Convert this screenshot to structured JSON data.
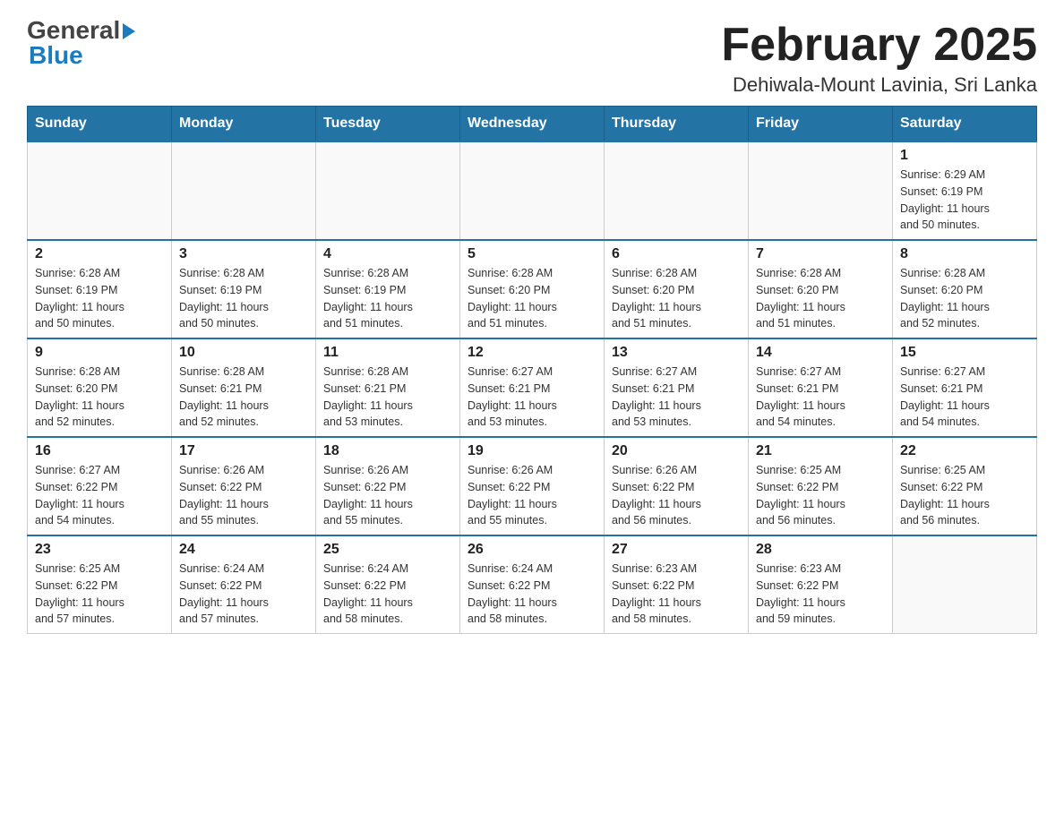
{
  "header": {
    "logo": {
      "line1": "General",
      "line2": "Blue"
    },
    "title": "February 2025",
    "subtitle": "Dehiwala-Mount Lavinia, Sri Lanka"
  },
  "days_of_week": [
    "Sunday",
    "Monday",
    "Tuesday",
    "Wednesday",
    "Thursday",
    "Friday",
    "Saturday"
  ],
  "weeks": [
    [
      {
        "day": "",
        "info": ""
      },
      {
        "day": "",
        "info": ""
      },
      {
        "day": "",
        "info": ""
      },
      {
        "day": "",
        "info": ""
      },
      {
        "day": "",
        "info": ""
      },
      {
        "day": "",
        "info": ""
      },
      {
        "day": "1",
        "info": "Sunrise: 6:29 AM\nSunset: 6:19 PM\nDaylight: 11 hours\nand 50 minutes."
      }
    ],
    [
      {
        "day": "2",
        "info": "Sunrise: 6:28 AM\nSunset: 6:19 PM\nDaylight: 11 hours\nand 50 minutes."
      },
      {
        "day": "3",
        "info": "Sunrise: 6:28 AM\nSunset: 6:19 PM\nDaylight: 11 hours\nand 50 minutes."
      },
      {
        "day": "4",
        "info": "Sunrise: 6:28 AM\nSunset: 6:19 PM\nDaylight: 11 hours\nand 51 minutes."
      },
      {
        "day": "5",
        "info": "Sunrise: 6:28 AM\nSunset: 6:20 PM\nDaylight: 11 hours\nand 51 minutes."
      },
      {
        "day": "6",
        "info": "Sunrise: 6:28 AM\nSunset: 6:20 PM\nDaylight: 11 hours\nand 51 minutes."
      },
      {
        "day": "7",
        "info": "Sunrise: 6:28 AM\nSunset: 6:20 PM\nDaylight: 11 hours\nand 51 minutes."
      },
      {
        "day": "8",
        "info": "Sunrise: 6:28 AM\nSunset: 6:20 PM\nDaylight: 11 hours\nand 52 minutes."
      }
    ],
    [
      {
        "day": "9",
        "info": "Sunrise: 6:28 AM\nSunset: 6:20 PM\nDaylight: 11 hours\nand 52 minutes."
      },
      {
        "day": "10",
        "info": "Sunrise: 6:28 AM\nSunset: 6:21 PM\nDaylight: 11 hours\nand 52 minutes."
      },
      {
        "day": "11",
        "info": "Sunrise: 6:28 AM\nSunset: 6:21 PM\nDaylight: 11 hours\nand 53 minutes."
      },
      {
        "day": "12",
        "info": "Sunrise: 6:27 AM\nSunset: 6:21 PM\nDaylight: 11 hours\nand 53 minutes."
      },
      {
        "day": "13",
        "info": "Sunrise: 6:27 AM\nSunset: 6:21 PM\nDaylight: 11 hours\nand 53 minutes."
      },
      {
        "day": "14",
        "info": "Sunrise: 6:27 AM\nSunset: 6:21 PM\nDaylight: 11 hours\nand 54 minutes."
      },
      {
        "day": "15",
        "info": "Sunrise: 6:27 AM\nSunset: 6:21 PM\nDaylight: 11 hours\nand 54 minutes."
      }
    ],
    [
      {
        "day": "16",
        "info": "Sunrise: 6:27 AM\nSunset: 6:22 PM\nDaylight: 11 hours\nand 54 minutes."
      },
      {
        "day": "17",
        "info": "Sunrise: 6:26 AM\nSunset: 6:22 PM\nDaylight: 11 hours\nand 55 minutes."
      },
      {
        "day": "18",
        "info": "Sunrise: 6:26 AM\nSunset: 6:22 PM\nDaylight: 11 hours\nand 55 minutes."
      },
      {
        "day": "19",
        "info": "Sunrise: 6:26 AM\nSunset: 6:22 PM\nDaylight: 11 hours\nand 55 minutes."
      },
      {
        "day": "20",
        "info": "Sunrise: 6:26 AM\nSunset: 6:22 PM\nDaylight: 11 hours\nand 56 minutes."
      },
      {
        "day": "21",
        "info": "Sunrise: 6:25 AM\nSunset: 6:22 PM\nDaylight: 11 hours\nand 56 minutes."
      },
      {
        "day": "22",
        "info": "Sunrise: 6:25 AM\nSunset: 6:22 PM\nDaylight: 11 hours\nand 56 minutes."
      }
    ],
    [
      {
        "day": "23",
        "info": "Sunrise: 6:25 AM\nSunset: 6:22 PM\nDaylight: 11 hours\nand 57 minutes."
      },
      {
        "day": "24",
        "info": "Sunrise: 6:24 AM\nSunset: 6:22 PM\nDaylight: 11 hours\nand 57 minutes."
      },
      {
        "day": "25",
        "info": "Sunrise: 6:24 AM\nSunset: 6:22 PM\nDaylight: 11 hours\nand 58 minutes."
      },
      {
        "day": "26",
        "info": "Sunrise: 6:24 AM\nSunset: 6:22 PM\nDaylight: 11 hours\nand 58 minutes."
      },
      {
        "day": "27",
        "info": "Sunrise: 6:23 AM\nSunset: 6:22 PM\nDaylight: 11 hours\nand 58 minutes."
      },
      {
        "day": "28",
        "info": "Sunrise: 6:23 AM\nSunset: 6:22 PM\nDaylight: 11 hours\nand 59 minutes."
      },
      {
        "day": "",
        "info": ""
      }
    ]
  ]
}
